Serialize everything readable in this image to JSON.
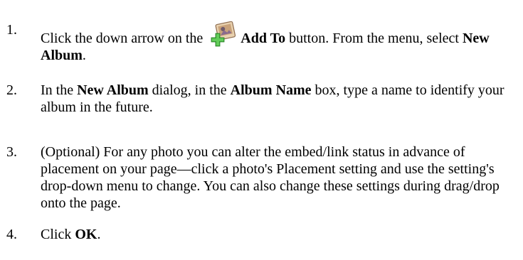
{
  "steps": [
    {
      "number": "1.",
      "text_before": "Click the down arrow on the ",
      "bold1": "Add To",
      "text_mid": " button. From the menu, select ",
      "bold2": "New Album",
      "text_after": "."
    },
    {
      "number": "2.",
      "text_before": "In the ",
      "bold1": "New Album",
      "text_mid": " dialog, in the ",
      "bold2": "Album Name",
      "text_after": " box, type a name to identify your album in the future."
    },
    {
      "number": "3.",
      "text": "(Optional) For any photo you can alter the embed/link status in advance of placement on your page—click a photo's Placement setting and use the setting's drop-down menu to change. You can also change these settings during drag/drop onto the page."
    },
    {
      "number": "4.",
      "text_before": "Click ",
      "bold1": "OK",
      "text_after": "."
    }
  ],
  "icons": {
    "add_to": "add-to-album-icon"
  }
}
